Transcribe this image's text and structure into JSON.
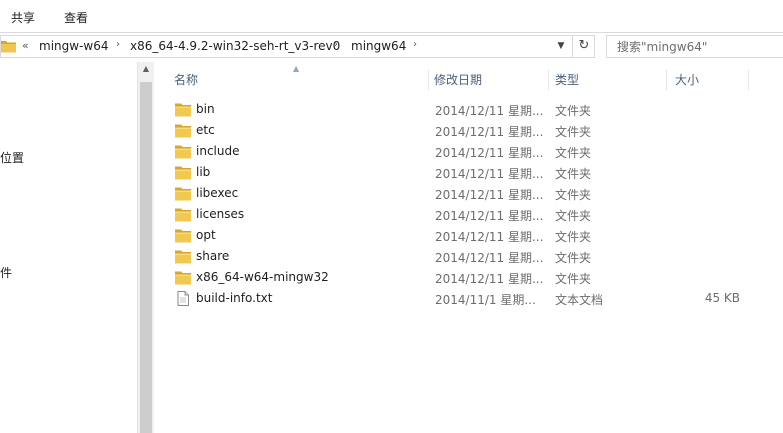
{
  "ribbon": {
    "tabs": [
      "共享",
      "查看"
    ]
  },
  "address": {
    "overflow": "«",
    "crumbs": [
      "mingw-w64",
      "x86_64-4.9.2-win32-seh-rt_v3-rev0",
      "mingw64"
    ],
    "separator": "›",
    "dropdown_icon": "chevron-down-icon",
    "refresh_icon": "refresh-icon"
  },
  "search": {
    "placeholder": "搜索\"mingw64\""
  },
  "nav": {
    "items": [
      "位置",
      "件"
    ]
  },
  "columns": {
    "name": "名称",
    "modified": "修改日期",
    "type": "类型",
    "size": "大小"
  },
  "files": [
    {
      "name": "bin",
      "date": "2014/12/11 星期...",
      "type": "文件夹",
      "size": "",
      "kind": "folder"
    },
    {
      "name": "etc",
      "date": "2014/12/11 星期...",
      "type": "文件夹",
      "size": "",
      "kind": "folder"
    },
    {
      "name": "include",
      "date": "2014/12/11 星期...",
      "type": "文件夹",
      "size": "",
      "kind": "folder"
    },
    {
      "name": "lib",
      "date": "2014/12/11 星期...",
      "type": "文件夹",
      "size": "",
      "kind": "folder"
    },
    {
      "name": "libexec",
      "date": "2014/12/11 星期...",
      "type": "文件夹",
      "size": "",
      "kind": "folder"
    },
    {
      "name": "licenses",
      "date": "2014/12/11 星期...",
      "type": "文件夹",
      "size": "",
      "kind": "folder"
    },
    {
      "name": "opt",
      "date": "2014/12/11 星期...",
      "type": "文件夹",
      "size": "",
      "kind": "folder"
    },
    {
      "name": "share",
      "date": "2014/12/11 星期...",
      "type": "文件夹",
      "size": "",
      "kind": "folder"
    },
    {
      "name": "x86_64-w64-mingw32",
      "date": "2014/12/11 星期...",
      "type": "文件夹",
      "size": "",
      "kind": "folder"
    },
    {
      "name": "build-info.txt",
      "date": "2014/11/1 星期...",
      "type": "文本文档",
      "size": "45 KB",
      "kind": "text-file"
    }
  ],
  "colors": {
    "folder": "#e8b83e",
    "header_text": "#4c607a",
    "detail_text": "#6d6d6d"
  }
}
